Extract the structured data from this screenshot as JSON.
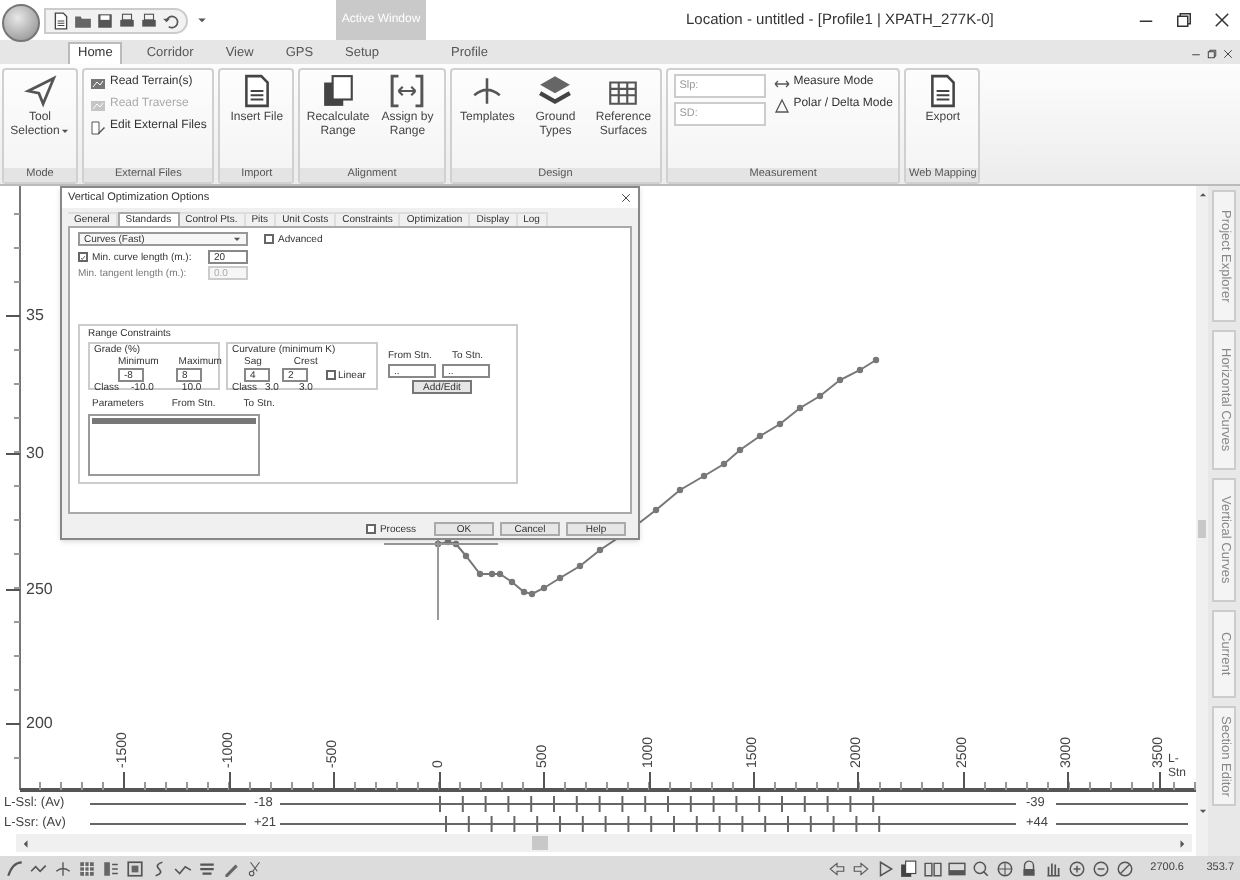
{
  "title_bar": {
    "contextual_tab": "Active Window",
    "title": "Location - untitled - [Profile1 | XPATH_277K-0]"
  },
  "tabs": [
    {
      "label": "Home",
      "selected": true
    },
    {
      "label": "Corridor",
      "selected": false
    },
    {
      "label": "View",
      "selected": false
    },
    {
      "label": "GPS",
      "selected": false
    },
    {
      "label": "Setup",
      "selected": false
    },
    {
      "label": "Profile",
      "selected": false
    }
  ],
  "ribbon": [
    {
      "label": "Mode",
      "items": [
        {
          "kind": "large",
          "label": "Tool Selection",
          "menu": true
        }
      ]
    },
    {
      "label": "External Files",
      "items": [
        {
          "kind": "small",
          "label": "Read Terrain(s)",
          "disabled": false
        },
        {
          "kind": "small",
          "label": "Read Traverse",
          "disabled": true
        },
        {
          "kind": "small",
          "label": "Edit External Files",
          "disabled": false
        }
      ]
    },
    {
      "label": "Import",
      "items": [
        {
          "kind": "large",
          "label": "Insert File",
          "menu": false
        }
      ]
    },
    {
      "label": "Alignment",
      "items": [
        {
          "kind": "large",
          "label": "Recalculate Range",
          "menu": false
        },
        {
          "kind": "large",
          "label": "Assign by Range",
          "menu": false
        }
      ]
    },
    {
      "label": "Design",
      "items": [
        {
          "kind": "large",
          "label": "Templates",
          "menu": false
        },
        {
          "kind": "large",
          "label": "Ground Types",
          "menu": false
        },
        {
          "kind": "large",
          "label": "Reference Surfaces",
          "menu": false
        }
      ]
    },
    {
      "label": "Measurement",
      "items": [
        {
          "kind": "field",
          "placeholder": "Slp:"
        },
        {
          "kind": "field",
          "placeholder": "SD:"
        },
        {
          "kind": "small",
          "label": "Measure Mode",
          "disabled": false
        },
        {
          "kind": "small",
          "label": "Polar / Delta Mode",
          "disabled": false
        }
      ]
    },
    {
      "label": "Web Mapping",
      "items": [
        {
          "kind": "large",
          "label": "Export",
          "menu": false
        }
      ]
    }
  ],
  "profile_view": {
    "y_labels": [
      "35",
      "30",
      "250",
      "200"
    ],
    "x_labels": [
      "-1500",
      "-1000",
      "-500",
      "0",
      "500",
      "1000",
      "1500",
      "2000",
      "2500",
      "3000",
      "3500"
    ],
    "x_axis_title": "L-Stn",
    "rows": [
      {
        "label": "L-Ssl: (Av)",
        "start": "-18",
        "end": "-39"
      },
      {
        "label": "L-Ssr: (Av)",
        "start": "+21",
        "end": "+44"
      }
    ]
  },
  "side_tabs": [
    "Project Explorer",
    "Horizontal Curves",
    "Vertical Curves",
    "Current",
    "Section Editor"
  ],
  "dialog": {
    "title": "Vertical Optimization Options",
    "tabs": [
      {
        "label": "General",
        "selected": false
      },
      {
        "label": "Standards",
        "selected": true
      },
      {
        "label": "Control Pts.",
        "selected": false
      },
      {
        "label": "Pits",
        "selected": false
      },
      {
        "label": "Unit Costs",
        "selected": false
      },
      {
        "label": "Constraints",
        "selected": false
      },
      {
        "label": "Optimization",
        "selected": false
      },
      {
        "label": "Display",
        "selected": false
      },
      {
        "label": "Log",
        "selected": false
      }
    ],
    "method": "Curves (Fast)",
    "advanced": {
      "label": "Advanced",
      "checked": false
    },
    "min_curve": {
      "label": "Min. curve length (m.):",
      "checked": true,
      "value": "20"
    },
    "min_tangent": {
      "label": "Min. tangent length (m.):",
      "value": "0.0",
      "disabled": true
    },
    "range_constraints": {
      "title": "Range Constraints",
      "grade": {
        "title": "Grade (%)",
        "min_label": "Minimum",
        "max_label": "Maximum",
        "min": "-8",
        "max": "8",
        "class_label": "Class",
        "class_min": "-10.0",
        "class_max": "10.0"
      },
      "curvature": {
        "title": "Curvature (minimum K)",
        "sag_label": "Sag",
        "crest_label": "Crest",
        "sag": "4",
        "crest": "2",
        "linear": {
          "label": "Linear",
          "checked": false
        },
        "class_label": "Class",
        "class_sag": "3.0",
        "class_crest": "3.0"
      },
      "from_label": "From Stn.",
      "to_label": "To Stn.",
      "from": "..",
      "to": "..",
      "add_button": "Add/Edit",
      "list_columns": [
        "Parameters",
        "From Stn.",
        "To Stn."
      ],
      "list_rows": [
        {
          "selected": true
        }
      ]
    },
    "process": {
      "label": "Process",
      "checked": false
    },
    "buttons": [
      "OK",
      "Cancel",
      "Help"
    ]
  },
  "status_bar": {
    "values": [
      "2700.6",
      "353.7"
    ]
  }
}
